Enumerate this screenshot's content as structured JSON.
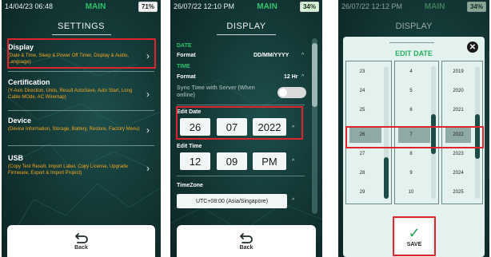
{
  "panel1": {
    "status": {
      "time": "14/04/23 06:48",
      "mode": "MAIN",
      "battery": "71%"
    },
    "title": "SETTINGS",
    "items": [
      {
        "label": "Display",
        "desc": "(Date & Time, Sleep & Power Off Timer, Display & Audio, Language)"
      },
      {
        "label": "Certification",
        "desc": "(Y-Axis Direction, Units, Result AutoSave, Auto Start, Long Cable MOde, AC Wiremap)"
      },
      {
        "label": "Device",
        "desc": "(Device Information, Storage, Battery, Restore, Factory Menu)"
      },
      {
        "label": "USB",
        "desc": "(Copy Test Result, Import Label, Copy License, Upgrade Firmware, Export & Import Project)"
      }
    ],
    "back_label": "Back"
  },
  "panel2": {
    "status": {
      "time": "26/07/22 12:10 PM",
      "mode": "MAIN",
      "battery": "34%"
    },
    "title": "DISPLAY",
    "date_section": "DATE",
    "format_label": "Format",
    "date_format_value": "DD/MM/YYYY",
    "time_section": "TIME",
    "time_format_value": "12 Hr",
    "sync_label": "Sync Time with Server (When online)",
    "edit_date_label": "Edit Date",
    "date_values": [
      "26",
      "07",
      "2022"
    ],
    "edit_time_label": "Edit Time",
    "time_values": [
      "12",
      "09",
      "PM"
    ],
    "timezone_label": "TimeZone",
    "timezone_value": "UTC+08:00 (Asia/Singapore)",
    "back_label": "Back"
  },
  "panel3": {
    "status": {
      "time": "26/07/22 12:12 PM",
      "mode": "MAIN",
      "battery": "34%"
    },
    "title": "DISPLAY",
    "modal_title": "EDIT DATE",
    "days": [
      "23",
      "24",
      "25",
      "26",
      "27",
      "28",
      "29"
    ],
    "months": [
      "4",
      "5",
      "6",
      "7",
      "8",
      "9",
      "10"
    ],
    "years": [
      "2019",
      "2020",
      "2021",
      "2022",
      "2023",
      "2024",
      "2025"
    ],
    "save_label": "SAVE"
  },
  "colors": {
    "accent_green": "#2fc06d",
    "highlight_red": "#e0242e",
    "orange": "#f5a623"
  }
}
